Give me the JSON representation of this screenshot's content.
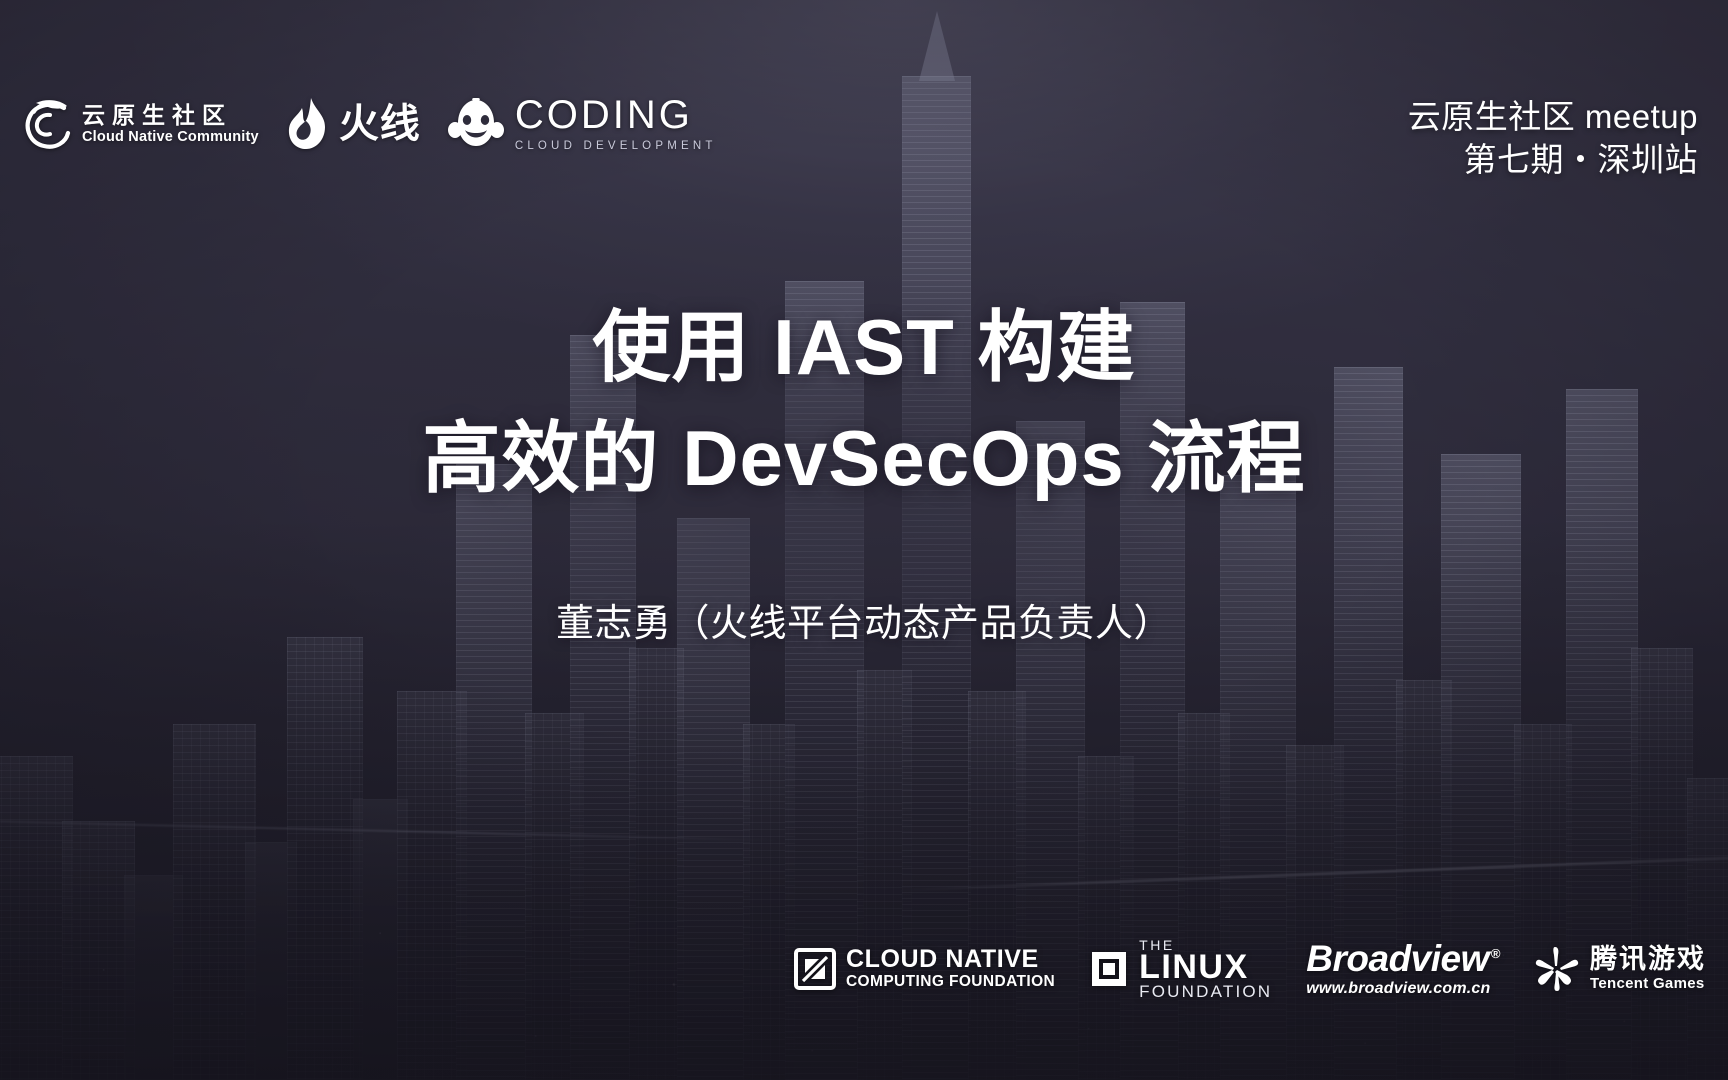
{
  "slide": {
    "background_image": "shenzhen-night-skyline",
    "overlay_color": "#2e2c3b"
  },
  "header": {
    "partner_logos": [
      {
        "name": "cloud-native-community",
        "icon": "cnc-swirl-icon",
        "cn_name": "云原生社区",
        "en_name": "Cloud Native Community"
      },
      {
        "name": "huoxian",
        "icon": "flame-icon",
        "cn_name": "火线"
      },
      {
        "name": "coding",
        "icon": "monkey-face-icon",
        "wordmark": "CODING",
        "tagline": "CLOUD DEVELOPMENT"
      }
    ],
    "event": {
      "line1": "云原生社区 meetup",
      "line2": "第七期・深圳站"
    }
  },
  "main": {
    "title_line_1": "使用 IAST 构建",
    "title_line_2": "高效的 DevSecOps 流程",
    "speaker": "董志勇（火线平台动态产品负责人）"
  },
  "footer": {
    "sponsors": [
      {
        "name": "cncf",
        "icon": "cncf-hexagon-icon",
        "line1": "CLOUD NATIVE",
        "line2": "COMPUTING FOUNDATION"
      },
      {
        "name": "linux-foundation",
        "icon": "linux-foundation-square-icon",
        "the": "THE",
        "linux": "LINUX",
        "foundation": "FOUNDATION"
      },
      {
        "name": "broadview",
        "wordmark": "Broadview",
        "registered": "®",
        "url": "www.broadview.com.cn"
      },
      {
        "name": "tencent-games",
        "icon": "tencent-games-star-icon",
        "cn_name": "腾讯游戏",
        "en_name": "Tencent Games"
      }
    ]
  },
  "colors": {
    "text": "#ffffff",
    "muted": "#c9cada",
    "backdrop": "#2e2c3b"
  }
}
